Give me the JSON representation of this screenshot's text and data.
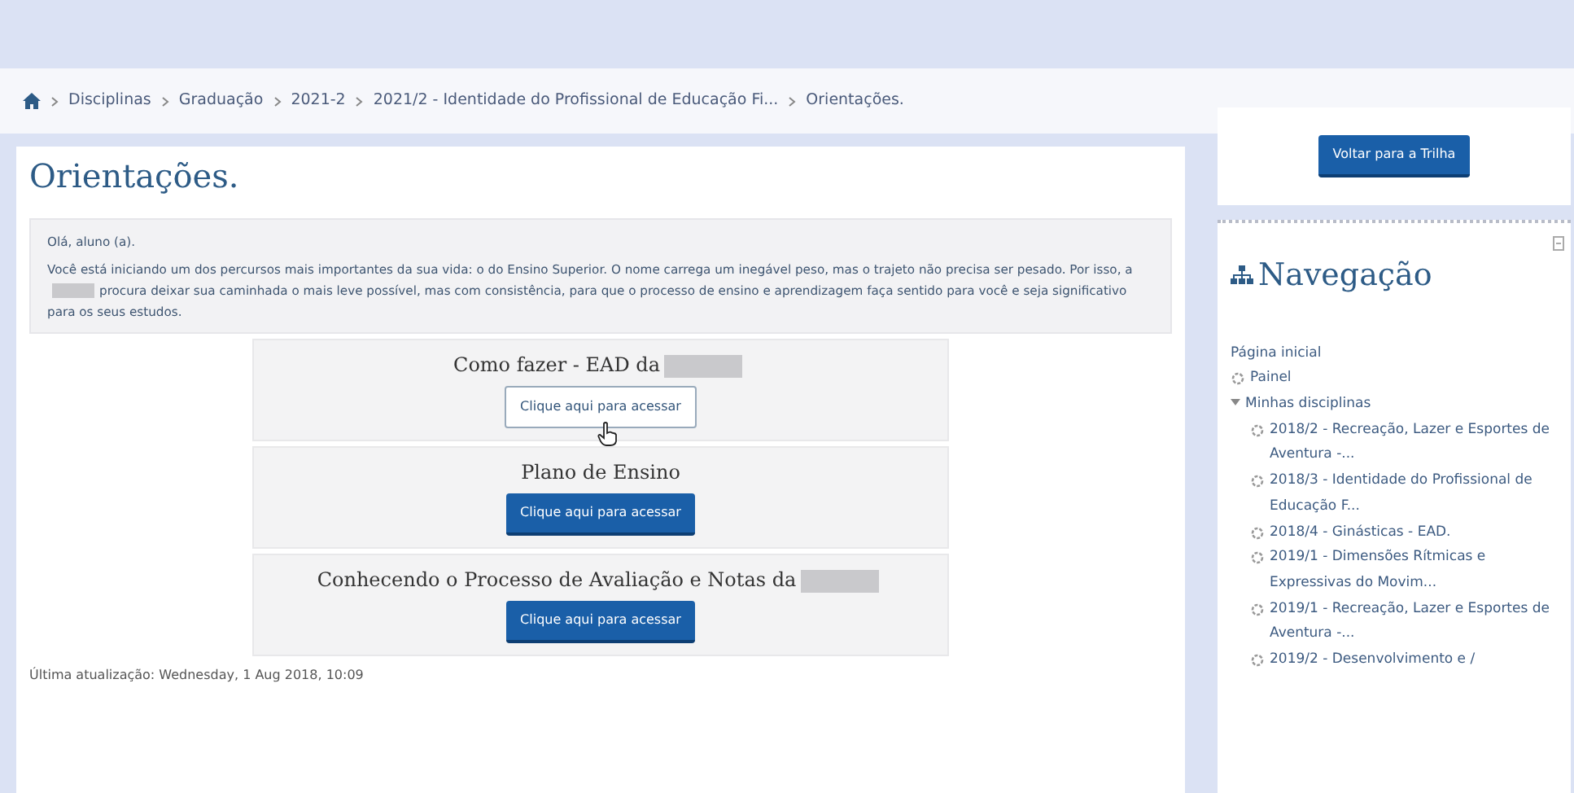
{
  "breadcrumb": [
    {
      "kind": "home"
    },
    {
      "kind": "link",
      "label": "Disciplinas"
    },
    {
      "kind": "link",
      "label": "Graduação"
    },
    {
      "kind": "link",
      "label": "2021-2"
    },
    {
      "kind": "link",
      "label": "2021/2 - Identidade do Profissional de Educação Fi..."
    },
    {
      "kind": "current",
      "label": "Orientações."
    }
  ],
  "page": {
    "title": "Orientações.",
    "intro": {
      "greeting": "Olá, aluno (a).",
      "paragraph": [
        {
          "kind": "text",
          "text": "Você está iniciando um dos percursos mais importantes da sua vida: o do Ensino Superior. O nome carrega um inegável peso, mas o trajeto não precisa ser pesado. Por isso, a"
        },
        {
          "kind": "redacted"
        },
        {
          "kind": "text",
          "text": "procura deixar sua caminhada o mais leve possível, mas com consistência, para que o processo de ensino e aprendizagem faça sentido para você e seja significativo para os seus estudos."
        }
      ]
    },
    "sections": [
      {
        "heading": "Como fazer - EAD da",
        "redacted": true,
        "button": "Clique aqui para acessar",
        "hovered": true
      },
      {
        "heading": "Plano de Ensino",
        "redacted": false,
        "button": "Clique aqui para acessar",
        "hovered": false
      },
      {
        "heading": "Conhecendo o Processo de Avaliação e Notas da",
        "redacted": true,
        "button": "Clique aqui para acessar",
        "hovered": false
      }
    ],
    "last_updated": "Última atualização: Wednesday, 1 Aug 2018, 10:09"
  },
  "sidebar": {
    "back_button": "Voltar para a Trilha",
    "navigation": {
      "title": "Navegação",
      "items": [
        {
          "kind": "plain",
          "label": "Página inicial"
        },
        {
          "kind": "course",
          "label": "Painel"
        },
        {
          "kind": "folder",
          "label": "Minhas disciplinas",
          "expanded": true,
          "children": [
            {
              "kind": "course",
              "label": "2018/2 - Recreação, Lazer e Esportes de Aventura -..."
            },
            {
              "kind": "course",
              "label": "2018/3 - Identidade do Profissional de Educação F..."
            },
            {
              "kind": "course",
              "label": "2018/4 - Ginásticas - EAD."
            },
            {
              "kind": "course",
              "label": "2019/1 - Dimensões Rítmicas e Expressivas do Movim..."
            },
            {
              "kind": "course",
              "label": "2019/1 - Recreação, Lazer e Esportes de Aventura -..."
            },
            {
              "kind": "course",
              "label": "2019/2 - Desenvolvimento e /"
            }
          ]
        }
      ]
    }
  }
}
